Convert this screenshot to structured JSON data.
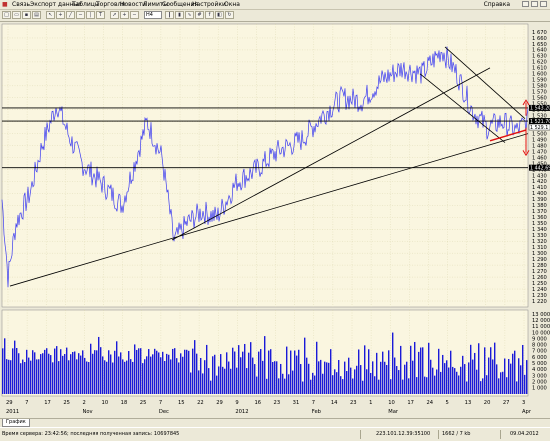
{
  "menu": [
    "Связь",
    "Экспорт данных",
    "Таблицы",
    "Торговля",
    "Новости",
    "Лимиты",
    "Сообщения",
    "Настройки",
    "Окна"
  ],
  "menu_right": "Справка",
  "toolbar": {
    "timeframe": "H4",
    "buttons": [
      "new-icon",
      "open-icon",
      "save-icon",
      "print-icon",
      "cursor-icon",
      "crosshair-icon",
      "line-icon",
      "hline-icon",
      "vline-icon",
      "text-icon",
      "arrow-icon",
      "zoomin-icon",
      "zoomout-icon",
      "bar-icon",
      "candle-icon",
      "linechart-icon",
      "grid-icon",
      "indicator-icon",
      "template-icon",
      "refresh-icon"
    ]
  },
  "price_axis": [
    "1 670",
    "1 660",
    "1 650",
    "1 640",
    "1 630",
    "1 620",
    "1 610",
    "1 600",
    "1 590",
    "1 580",
    "1 570",
    "1 560",
    "1 550",
    "1 540",
    "1 530",
    "1 520",
    "1 510",
    "1 500",
    "1 490",
    "1 480",
    "1 470",
    "1 460",
    "1 450",
    "1 440",
    "1 430",
    "1 420",
    "1 410",
    "1 400",
    "1 390",
    "1 380",
    "1 370",
    "1 360",
    "1 350",
    "1 340",
    "1 330",
    "1 320",
    "1 310",
    "1 300",
    "1 290",
    "1 280",
    "1 270",
    "1 260",
    "1 250",
    "1 240",
    "1 230",
    "1 220"
  ],
  "price_labels": {
    "upper": "1 543.20",
    "mid": "1 521.70",
    "last": "1 529.1",
    "lower": "1 442.69"
  },
  "volume_axis": [
    "13 000",
    "12 000",
    "11 000",
    "10 000",
    "9 000",
    "8 000",
    "7 000",
    "6 000",
    "5 000",
    "4 000",
    "3 000",
    "2 000",
    "1 000"
  ],
  "date_top": [
    "29",
    "7",
    "17",
    "25",
    "2",
    "10",
    "18",
    "25",
    "7",
    "15",
    "22",
    "29",
    "9",
    "16",
    "23",
    "31",
    "7",
    "14",
    "23",
    "1",
    "10",
    "17",
    "24",
    "5",
    "13",
    "20",
    "27",
    "3"
  ],
  "date_bottom": [
    {
      "label": "2011",
      "pos": 0
    },
    {
      "label": "Nov",
      "pos": 4
    },
    {
      "label": "Dec",
      "pos": 8
    },
    {
      "label": "2012",
      "pos": 12
    },
    {
      "label": "Feb",
      "pos": 16
    },
    {
      "label": "Mar",
      "pos": 20
    },
    {
      "label": "Apr",
      "pos": 27
    }
  ],
  "tab": "График",
  "status": {
    "server_time": "Время сервера: 23:42:56; последняя полученная запись: 10697845",
    "ip": "223.101.12.39:35100",
    "latency": "1662 / 7 kb",
    "date": "09.04.2012"
  },
  "colors": {
    "chart_bg": "#faf6e0",
    "price_line": "#3a3af0",
    "volume": "#1a1ad8",
    "grid": "#d8d3a8",
    "level_line": "#000000",
    "arrow": "#e01010"
  }
}
